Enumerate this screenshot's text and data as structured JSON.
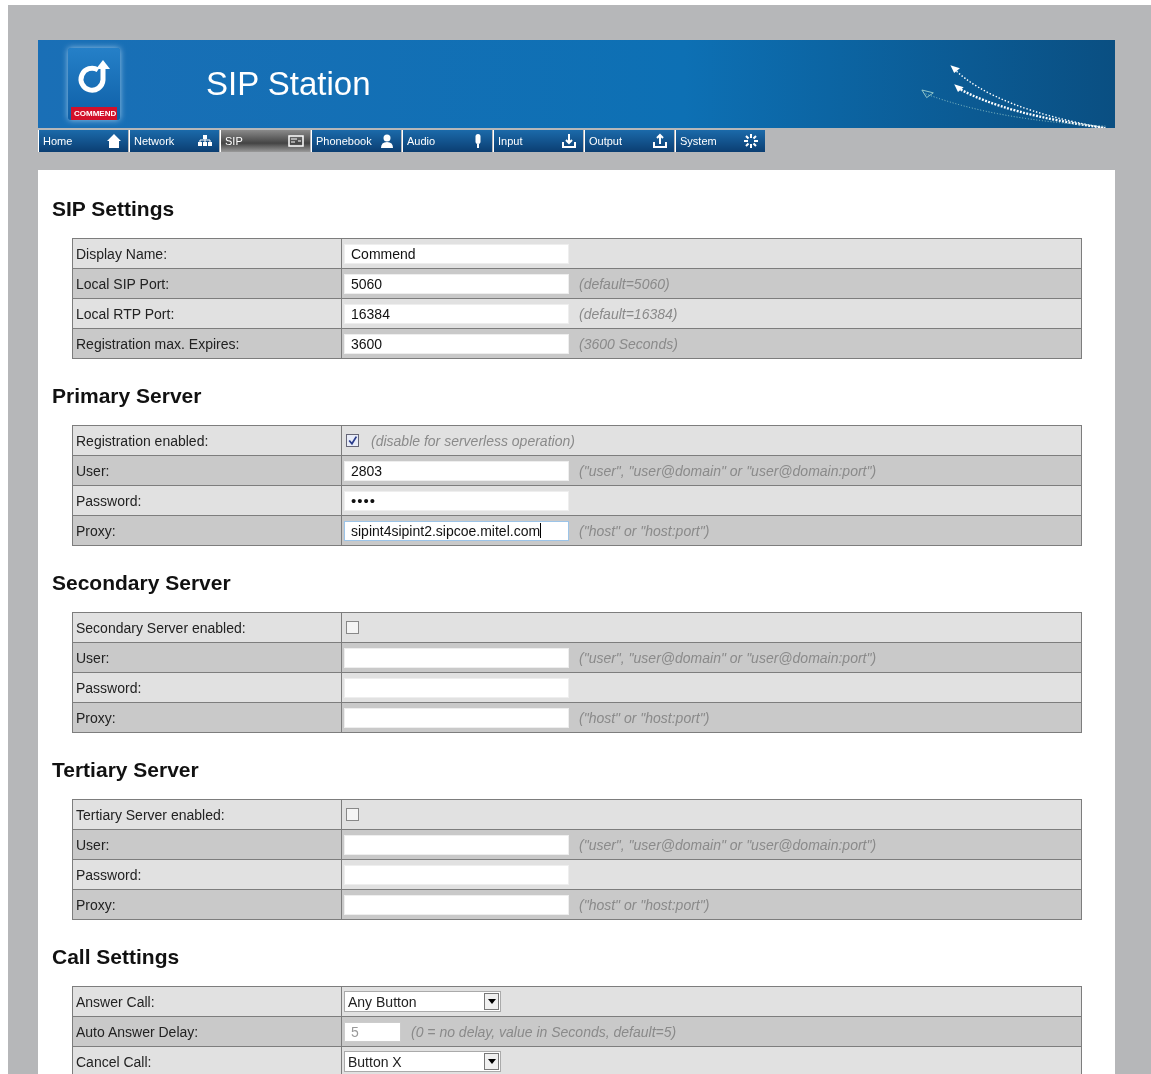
{
  "header": {
    "logo_text": "COMMEND",
    "title": "SIP Station"
  },
  "nav": [
    {
      "label": "Home",
      "selected": false
    },
    {
      "label": "Network",
      "selected": false
    },
    {
      "label": "SIP",
      "selected": true
    },
    {
      "label": "Phonebook",
      "selected": false
    },
    {
      "label": "Audio",
      "selected": false
    },
    {
      "label": "Input",
      "selected": false
    },
    {
      "label": "Output",
      "selected": false
    },
    {
      "label": "System",
      "selected": false
    }
  ],
  "sections": [
    {
      "title": "SIP Settings",
      "rows": [
        {
          "kind": "text",
          "label": "Display Name:",
          "value": "Commend"
        },
        {
          "kind": "text",
          "label": "Local SIP Port:",
          "value": "5060",
          "hint": "(default=5060)"
        },
        {
          "kind": "text",
          "label": "Local RTP Port:",
          "value": "16384",
          "hint": "(default=16384)"
        },
        {
          "kind": "text",
          "label": "Registration max. Expires:",
          "value": "3600",
          "hint": "(3600 Seconds)"
        }
      ]
    },
    {
      "title": "Primary Server",
      "rows": [
        {
          "kind": "checkbox",
          "label": "Registration enabled:",
          "checked": true,
          "hint": "(disable for serverless operation)"
        },
        {
          "kind": "text",
          "label": "User:",
          "value": "2803",
          "hint": "(\"user\", \"user@domain\" or \"user@domain:port\")"
        },
        {
          "kind": "password",
          "label": "Password:",
          "value": "••••"
        },
        {
          "kind": "text",
          "label": "Proxy:",
          "value": "sipint4sipint2.sipcoe.mitel.com",
          "hint": "(\"host\" or \"host:port\")",
          "focused": true
        }
      ]
    },
    {
      "title": "Secondary Server",
      "rows": [
        {
          "kind": "checkbox",
          "label": "Secondary Server enabled:",
          "checked": false
        },
        {
          "kind": "text",
          "label": "User:",
          "hint": "(\"user\", \"user@domain\" or \"user@domain:port\")"
        },
        {
          "kind": "password",
          "label": "Password:"
        },
        {
          "kind": "text",
          "label": "Proxy:",
          "hint": "(\"host\" or \"host:port\")"
        }
      ]
    },
    {
      "title": "Tertiary Server",
      "rows": [
        {
          "kind": "checkbox",
          "label": "Tertiary Server enabled:",
          "checked": false
        },
        {
          "kind": "text",
          "label": "User:",
          "hint": "(\"user\", \"user@domain\" or \"user@domain:port\")"
        },
        {
          "kind": "password",
          "label": "Password:"
        },
        {
          "kind": "text",
          "label": "Proxy:",
          "hint": "(\"host\" or \"host:port\")"
        }
      ]
    },
    {
      "title": "Call Settings",
      "rows": [
        {
          "kind": "select",
          "label": "Answer Call:",
          "value": "Any Button"
        },
        {
          "kind": "number",
          "label": "Auto Answer Delay:",
          "value": "5",
          "disabled": true,
          "hint": "(0 = no delay, value in Seconds, default=5)"
        },
        {
          "kind": "select",
          "label": "Cancel Call:",
          "value": "Button X"
        }
      ]
    }
  ]
}
